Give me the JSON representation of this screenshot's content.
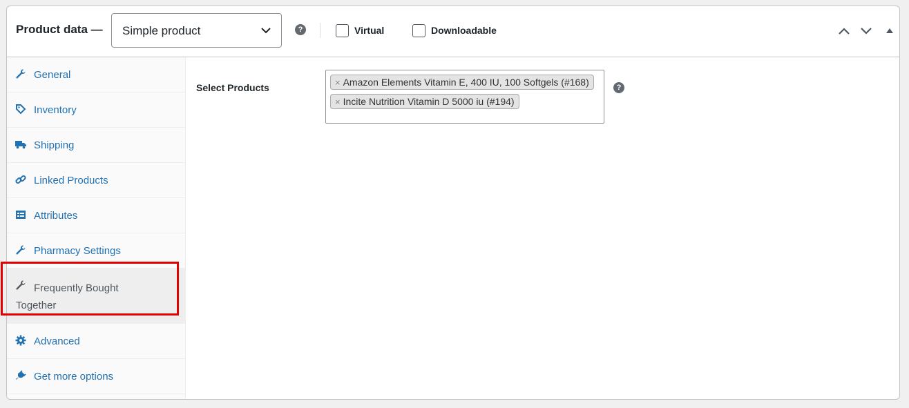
{
  "header": {
    "title": "Product data —",
    "product_type": "Simple product",
    "help_glyph": "?",
    "virtual_label": "Virtual",
    "downloadable_label": "Downloadable"
  },
  "tabs": [
    {
      "label": "General",
      "icon": "wrench-icon"
    },
    {
      "label": "Inventory",
      "icon": "tag-icon"
    },
    {
      "label": "Shipping",
      "icon": "truck-icon"
    },
    {
      "label": "Linked Products",
      "icon": "link-icon"
    },
    {
      "label": "Attributes",
      "icon": "list-icon"
    },
    {
      "label": "Pharmacy Settings",
      "icon": "wrench-icon"
    },
    {
      "label": "Frequently Bought Together",
      "icon": "wrench-icon",
      "active": true
    },
    {
      "label": "Advanced",
      "icon": "gear-icon"
    },
    {
      "label": "Get more options",
      "icon": "plugin-icon"
    }
  ],
  "content": {
    "field_label": "Select Products",
    "selected_products": [
      "Amazon Elements Vitamin E, 400 IU, 100 Softgels (#168)",
      "Incite Nutrition Vitamin D 5000 iu (#194)"
    ],
    "remove_glyph": "×",
    "help_glyph": "?"
  },
  "colors": {
    "link": "#2271b1",
    "highlight_border": "#e50000",
    "active_tab_bg": "#eeeeee"
  }
}
